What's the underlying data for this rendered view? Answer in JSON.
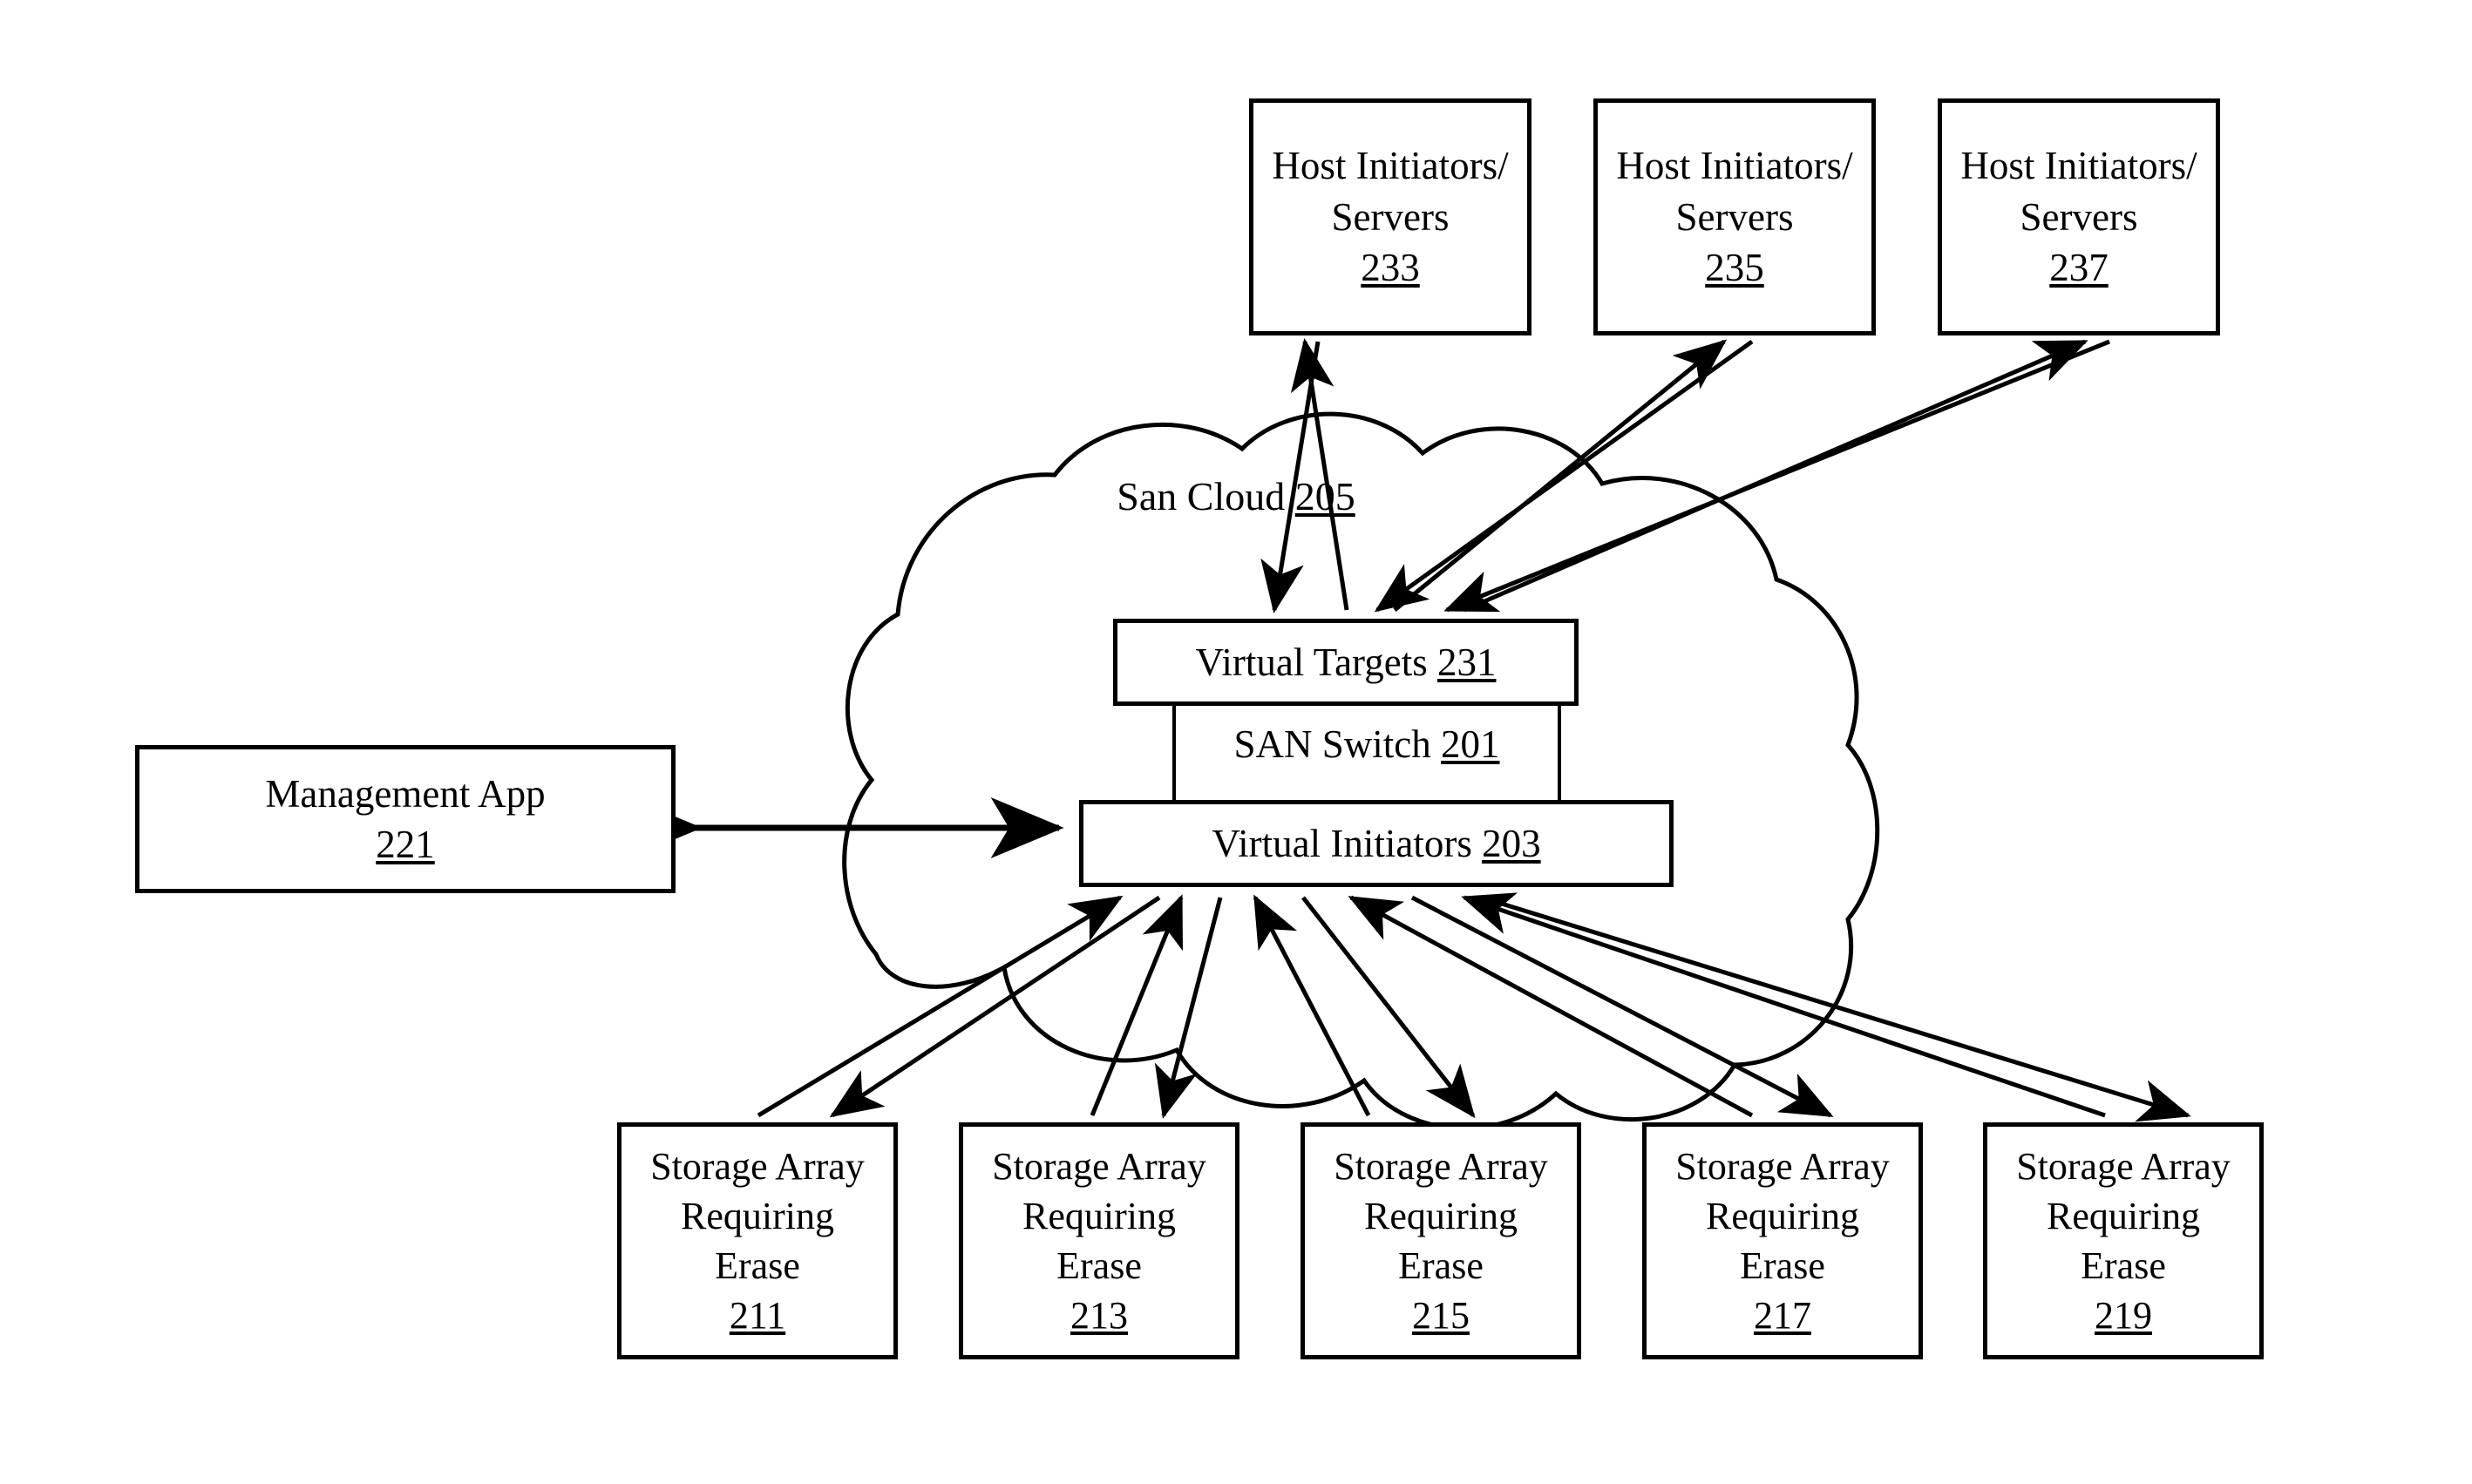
{
  "figure": {
    "title": "SAN switch virtualization diagram",
    "line_color": "#000000",
    "background_color": "#ffffff"
  },
  "cloud": {
    "name": "San Cloud",
    "ref": "205"
  },
  "switch": {
    "san_switch": {
      "label": "SAN Switch",
      "ref": "201"
    },
    "virtual_targets": {
      "label": "Virtual Targets",
      "ref": "231"
    },
    "virtual_initiators": {
      "label": "Virtual Initiators",
      "ref": "203"
    }
  },
  "management": {
    "label": "Management App",
    "ref": "221"
  },
  "hosts": [
    {
      "line1": "Host Initiators/",
      "line2": "Servers",
      "ref": "233"
    },
    {
      "line1": "Host Initiators/",
      "line2": "Servers",
      "ref": "235"
    },
    {
      "line1": "Host Initiators/",
      "line2": "Servers",
      "ref": "237"
    }
  ],
  "arrays": [
    {
      "line1": "Storage Array",
      "line2": "Requiring",
      "line3": "Erase",
      "ref": "211"
    },
    {
      "line1": "Storage Array",
      "line2": "Requiring",
      "line3": "Erase",
      "ref": "213"
    },
    {
      "line1": "Storage Array",
      "line2": "Requiring",
      "line3": "Erase",
      "ref": "215"
    },
    {
      "line1": "Storage Array",
      "line2": "Requiring",
      "line3": "Erase",
      "ref": "217"
    },
    {
      "line1": "Storage Array",
      "line2": "Requiring",
      "line3": "Erase",
      "ref": "219"
    }
  ],
  "connections": {
    "management_to_switch": "bidirectional",
    "hosts_to_virtual_targets": "bidirectional",
    "arrays_to_virtual_initiators": "bidirectional"
  }
}
